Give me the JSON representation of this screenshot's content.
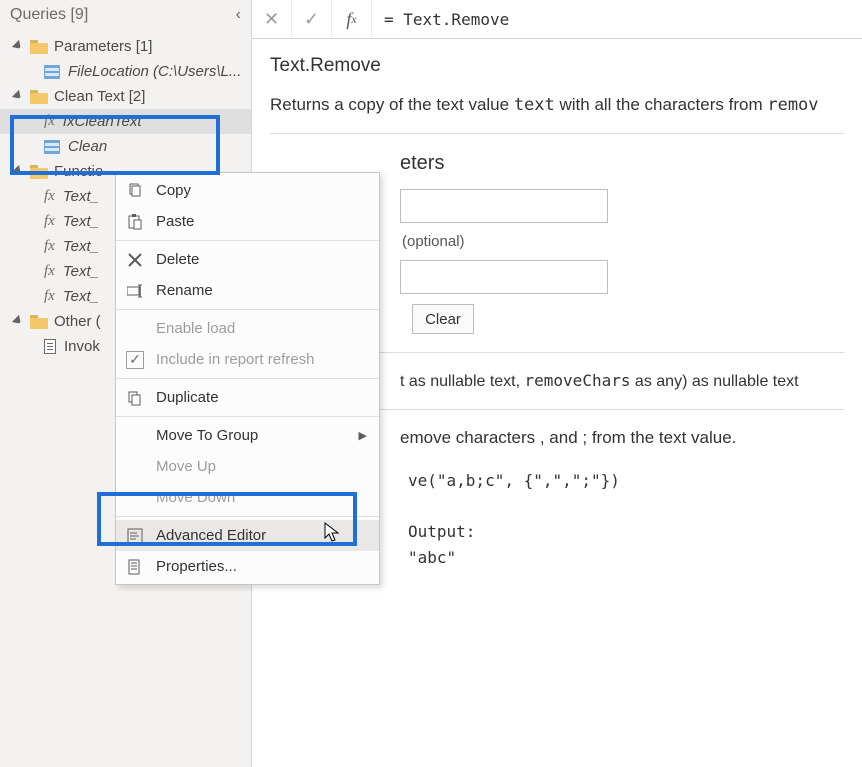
{
  "sidebar": {
    "title": "Queries [9]",
    "groups": [
      {
        "label": "Parameters [1]",
        "items": [
          {
            "kind": "tbl",
            "label": "FileLocation (C:\\Users\\L...",
            "italic": true
          }
        ]
      },
      {
        "label": "Clean Text [2]",
        "items": [
          {
            "kind": "fx",
            "label": "fxCleanText",
            "italic": true,
            "selected": true
          },
          {
            "kind": "tbl",
            "label": "Clean",
            "italic": true
          }
        ]
      },
      {
        "label": "Functio",
        "items": [
          {
            "kind": "fx",
            "label": "Text_",
            "italic": true
          },
          {
            "kind": "fx",
            "label": "Text_",
            "italic": true
          },
          {
            "kind": "fx",
            "label": "Text_",
            "italic": true
          },
          {
            "kind": "fx",
            "label": "Text_",
            "italic": true
          },
          {
            "kind": "fx",
            "label": "Text_",
            "italic": true
          }
        ]
      },
      {
        "label": "Other (",
        "items": [
          {
            "kind": "doc",
            "label": "Invok",
            "italic": false
          }
        ]
      }
    ]
  },
  "formula_bar": {
    "value": "= Text.Remove"
  },
  "doc": {
    "title": "Text.Remove",
    "description_pre": "Returns a copy of the text value ",
    "description_code1": "text",
    "description_mid": " with all the characters from ",
    "description_code2": "remov",
    "params_heading_tail": "eters",
    "optional_label": "(optional)",
    "clear_label": "Clear",
    "signature_tail_1": "t as nullable text, ",
    "signature_code": "removeChars",
    "signature_tail_2": " as any) as nullable text",
    "example_tail": "emove characters , and ; from the text value.",
    "code_line_1": "ve(\"a,b;c\", {\",\",\";\"})",
    "output_label": "Output:",
    "output_value": "\"abc\""
  },
  "context_menu": {
    "copy": "Copy",
    "paste": "Paste",
    "delete": "Delete",
    "rename": "Rename",
    "enable_load": "Enable load",
    "include_refresh": "Include in report refresh",
    "duplicate": "Duplicate",
    "move_to_group": "Move To Group",
    "move_up": "Move Up",
    "move_down": "Move Down",
    "advanced_editor": "Advanced Editor",
    "properties": "Properties..."
  }
}
